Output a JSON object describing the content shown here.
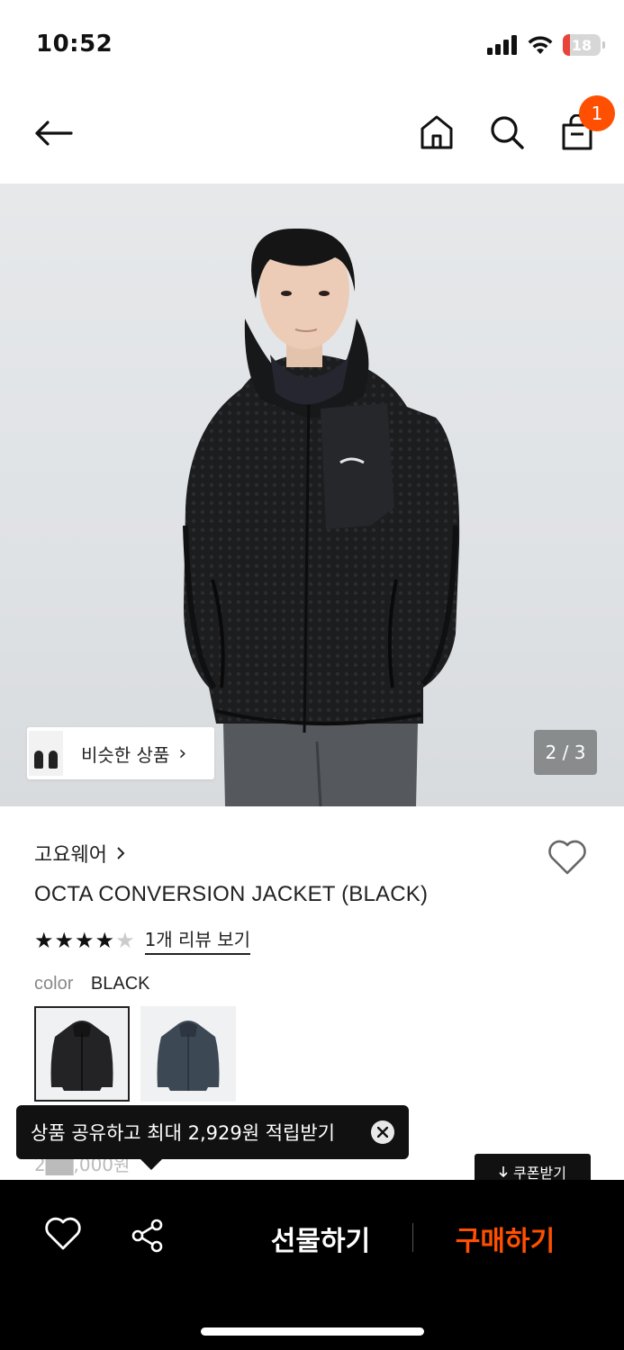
{
  "status_bar": {
    "time": "10:52",
    "battery": "18"
  },
  "nav": {
    "cart_count": "1"
  },
  "hero": {
    "similar_label": "비슷한 상품",
    "page_indicator": "2 / 3"
  },
  "product": {
    "brand": "고요웨어",
    "name": "OCTA CONVERSION JACKET (BLACK)",
    "rating_stars_filled": 4,
    "rating_stars_total": 5,
    "review_link": "1개 리뷰 보기",
    "color_label": "color",
    "color_value": "BLACK",
    "swatches": [
      "black",
      "navy"
    ],
    "price_partial": "2██,000원"
  },
  "tooltip": {
    "text": "상품 공유하고 최대 2,929원 적립받기"
  },
  "coupon": {
    "label": "쿠폰받기"
  },
  "bottom_bar": {
    "gift_label": "선물하기",
    "buy_label": "구매하기"
  },
  "colors": {
    "accent": "#ff4f00",
    "bar": "#000000"
  }
}
